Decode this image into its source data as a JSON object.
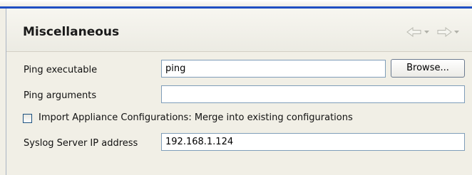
{
  "section": {
    "title": "Miscellaneous"
  },
  "nav": {
    "back_icon": "back-arrow-icon",
    "forward_icon": "forward-arrow-icon",
    "dropdown_icon": "chevron-down-icon"
  },
  "fields": {
    "ping_executable": {
      "label": "Ping executable",
      "value": "ping",
      "button_label": "Browse..."
    },
    "ping_arguments": {
      "label": "Ping arguments",
      "value": ""
    },
    "import_appliance": {
      "label": "Import Appliance Configurations: Merge into existing configurations",
      "checked": false
    },
    "syslog_server": {
      "label": "Syslog Server IP address",
      "value": "192.168.1.124"
    }
  },
  "colors": {
    "accent_line": "#1f4fc3",
    "input_border": "#7f9db9",
    "panel_bg": "#f1efe6"
  }
}
